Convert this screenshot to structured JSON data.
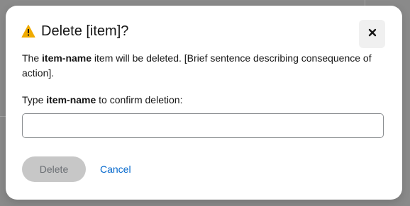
{
  "dialog": {
    "title": "Delete [item]?",
    "title_icon": "warning-icon",
    "close_icon": "close-icon",
    "body": {
      "prefix": "The ",
      "item_name": "item-name",
      "suffix": " item will be deleted. [Brief sentence describing consequence of action]."
    },
    "confirm": {
      "prefix": "Type ",
      "item_name": "item-name",
      "suffix": " to confirm deletion:",
      "input_value": ""
    },
    "buttons": {
      "delete_label": "Delete",
      "cancel_label": "Cancel"
    }
  },
  "colors": {
    "warning": "#f0ab00",
    "link": "#0066cc",
    "disabled_bg": "#c7c7c7",
    "disabled_text": "#6a6e73",
    "backdrop": "#8a8a8a"
  }
}
